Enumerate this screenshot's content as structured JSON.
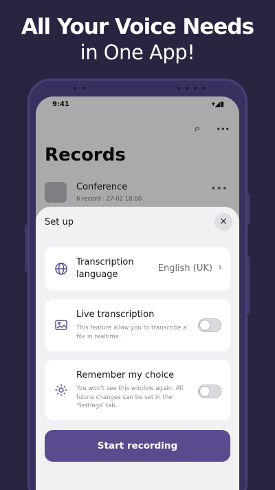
{
  "headline": {
    "line1": "All Your Voice Needs",
    "line2": "in One App!"
  },
  "status_bar": {
    "time": "9:41",
    "icons": "▾◢▮"
  },
  "top_actions": {
    "search_icon": "⌕",
    "more_icon": "•••"
  },
  "records": {
    "title": "Records",
    "items": [
      {
        "name": "Conference",
        "meta": "6 record · 27-02 18:00",
        "more": "•••"
      }
    ]
  },
  "setup_sheet": {
    "title": "Set up",
    "close_icon": "✕",
    "transcription_language": {
      "label": "Transcription language",
      "value": "English (UK)",
      "chevron": "›"
    },
    "live_transcription": {
      "title": "Live transcription",
      "description": "This feature allow you to transcribe a file in realtime.",
      "enabled": false
    },
    "remember_choice": {
      "title": "Remember my choice",
      "description": "You won't see this window again. All future changes can be set in the 'Settings' tab.",
      "enabled": false
    },
    "start_button": "Start recording"
  },
  "colors": {
    "background": "#2a2440",
    "accent": "#5a4b8f",
    "sheet": "#f1f1f3"
  }
}
